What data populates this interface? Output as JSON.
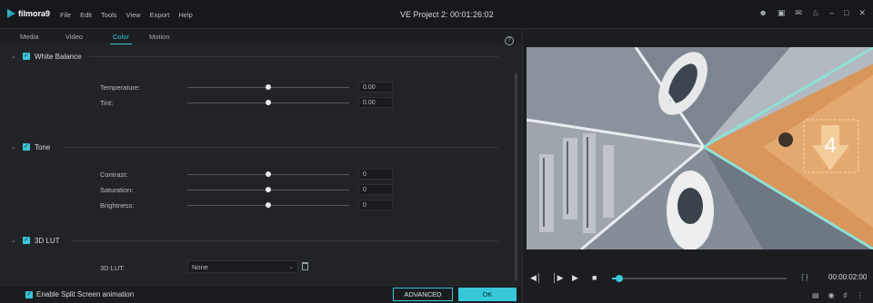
{
  "app": {
    "name": "filmora9",
    "project_title": "VE Project 2: 00:01:26:02"
  },
  "menu": [
    "File",
    "Edit",
    "Tools",
    "View",
    "Export",
    "Help"
  ],
  "tabs": [
    {
      "label": "Media",
      "active": false
    },
    {
      "label": "Video",
      "active": false
    },
    {
      "label": "Color",
      "active": true
    },
    {
      "label": "Motion",
      "active": false
    }
  ],
  "sections": {
    "white_balance": {
      "title": "White Balance",
      "rows": [
        {
          "label": "Temperature:",
          "value": "0.00",
          "level": 0.5
        },
        {
          "label": "Tint:",
          "value": "0.00",
          "level": 0.5
        }
      ]
    },
    "tone": {
      "title": "Tone",
      "rows": [
        {
          "label": "Contrast:",
          "value": "0",
          "level": 0.5
        },
        {
          "label": "Saturation:",
          "value": "0",
          "level": 0.5
        },
        {
          "label": "Brightness:",
          "value": "0",
          "level": 0.5
        }
      ]
    },
    "lut": {
      "title": "3D LUT",
      "label": "3D LUT:",
      "selected": "None"
    }
  },
  "footer": {
    "split_screen_label": "Enable Split Screen animation",
    "advanced_label": "ADVANCED",
    "ok_label": "OK"
  },
  "preview": {
    "countdown": "4",
    "timecode": "00:00:02:00",
    "brackets": "{ }",
    "progress": 0.04
  },
  "colors": {
    "accent": "#36c7d8",
    "panel": "#222326",
    "titlebar": "#17181b"
  }
}
